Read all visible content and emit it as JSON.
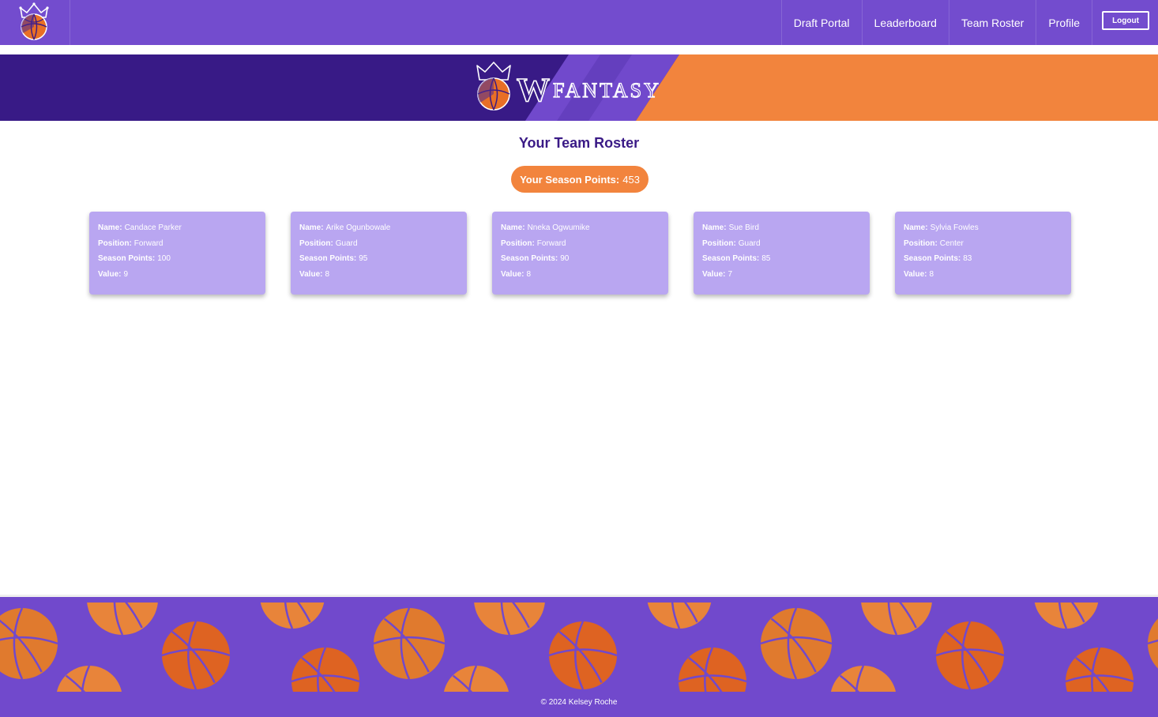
{
  "nav": {
    "links": [
      "Draft Portal",
      "Leaderboard",
      "Team Roster",
      "Profile"
    ],
    "logout_label": "Logout"
  },
  "banner": {
    "logo_w": "W",
    "logo_rest": "FANTASY"
  },
  "main": {
    "title": "Your Team Roster",
    "points_label": "Your Season Points:",
    "points_value": "453",
    "field_labels": {
      "name": "Name:",
      "position": "Position:",
      "points": "Season Points:",
      "value": "Value:"
    },
    "players": [
      {
        "name": "Candace Parker",
        "position": "Forward",
        "points": "100",
        "value": "9"
      },
      {
        "name": "Arike Ogunbowale",
        "position": "Guard",
        "points": "95",
        "value": "8"
      },
      {
        "name": "Nneka Ogwumike",
        "position": "Forward",
        "points": "90",
        "value": "8"
      },
      {
        "name": "Sue Bird",
        "position": "Guard",
        "points": "85",
        "value": "7"
      },
      {
        "name": "Sylvia Fowles",
        "position": "Center",
        "points": "83",
        "value": "8"
      }
    ]
  },
  "footer": {
    "copyright": "© 2024 Kelsey Roche"
  },
  "colors": {
    "nav_purple": "#734cce",
    "banner_dark_purple": "#381a86",
    "banner_orange": "#f2843d",
    "card_lavender": "#b9a6f1",
    "title_purple": "#3a1a86"
  },
  "icons": {
    "brand": "crowned-basketball-icon",
    "footer": "basketball-pattern"
  }
}
